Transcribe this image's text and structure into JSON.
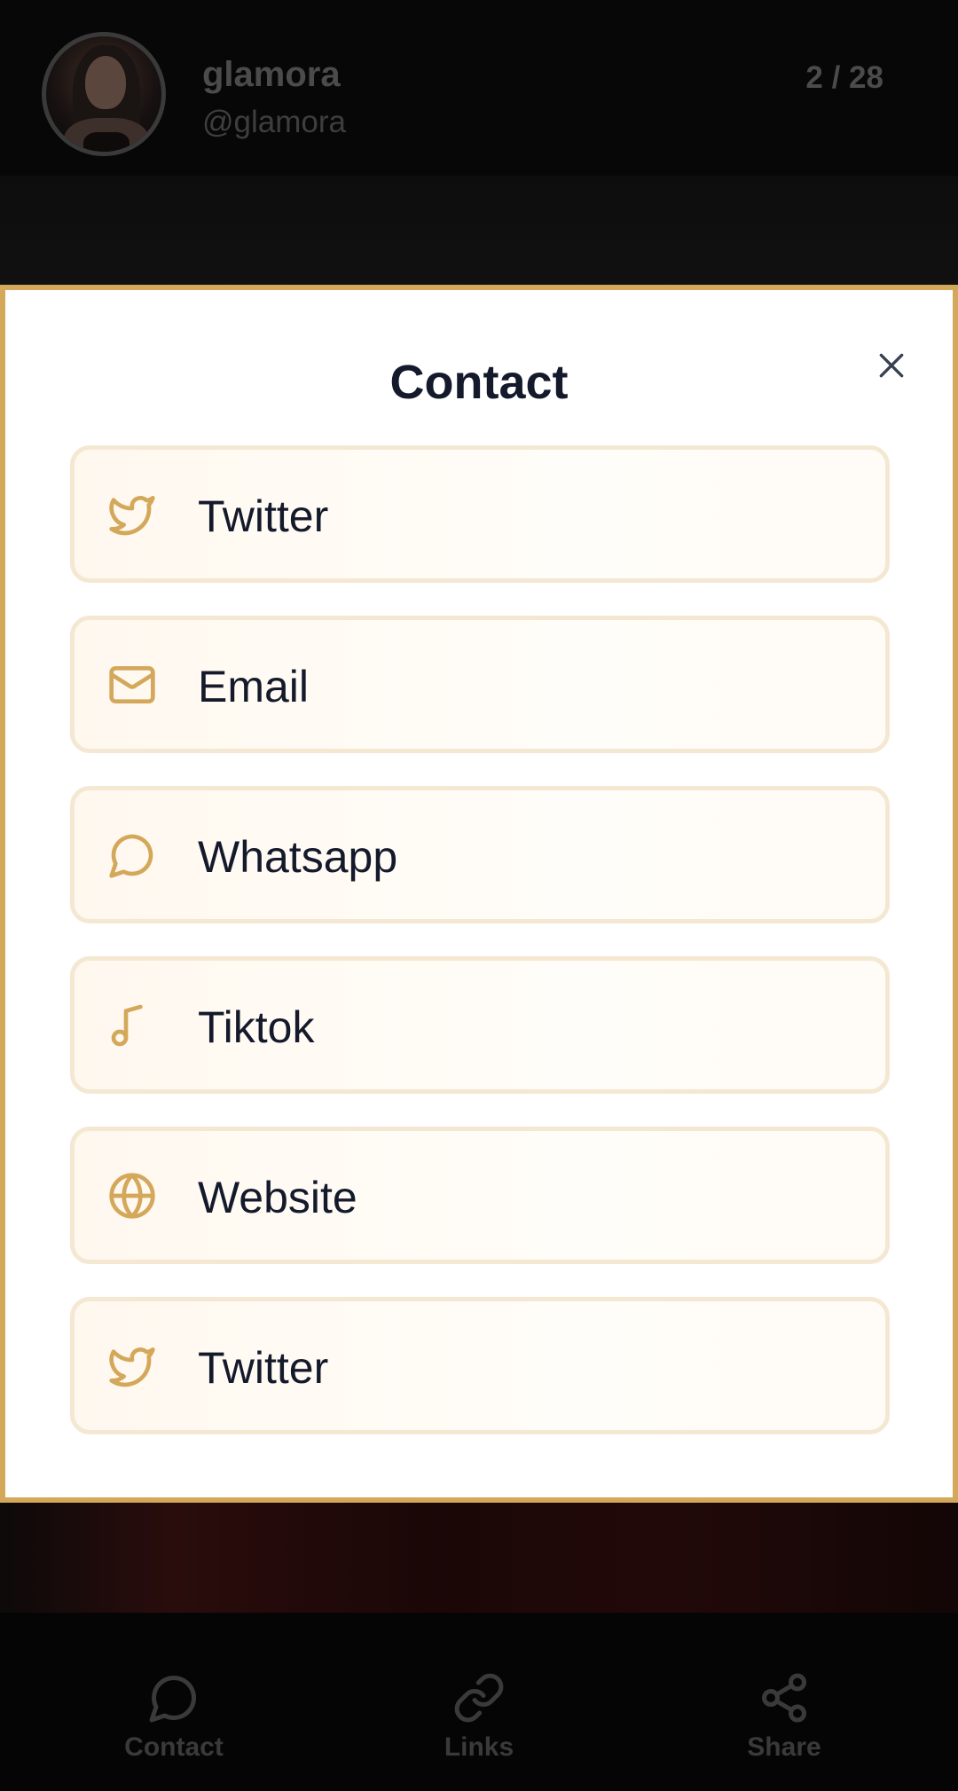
{
  "profile": {
    "name": "glamora",
    "handle": "@glamora",
    "counter": "2 / 28"
  },
  "modal": {
    "title": "Contact",
    "close_icon": "close-icon",
    "items": [
      {
        "label": "Twitter",
        "icon": "twitter-icon"
      },
      {
        "label": "Email",
        "icon": "mail-icon"
      },
      {
        "label": "Whatsapp",
        "icon": "chat-bubble-icon"
      },
      {
        "label": "Tiktok",
        "icon": "music-note-icon"
      },
      {
        "label": "Website",
        "icon": "globe-icon"
      },
      {
        "label": "Twitter",
        "icon": "twitter-icon"
      }
    ]
  },
  "bottom_nav": {
    "contact": {
      "label": "Contact",
      "icon": "chat-bubble-icon"
    },
    "links": {
      "label": "Links",
      "icon": "link-icon"
    },
    "share": {
      "label": "Share",
      "icon": "share-icon"
    }
  },
  "colors": {
    "accent": "#d4a85a",
    "item_border": "#f5e8d3",
    "item_background": "#fff8ef",
    "text_dark": "#141a2b"
  }
}
